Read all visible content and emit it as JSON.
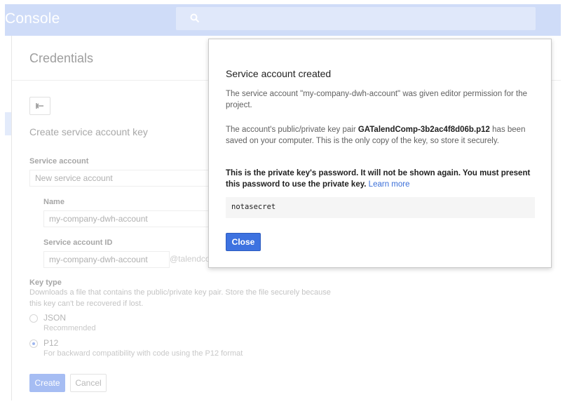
{
  "app": {
    "brand": "Console"
  },
  "search": {
    "icon": "search-icon"
  },
  "page": {
    "title": "Credentials",
    "back_icon": "back-arrow-icon",
    "section_title": "Create service account key",
    "service_account": {
      "label": "Service account",
      "selected": "New service account"
    },
    "name": {
      "label": "Name",
      "value": "my-company-dwh-account"
    },
    "service_account_id": {
      "label": "Service account ID",
      "value": "my-company-dwh-account",
      "suffix": "@talendco"
    },
    "key_type": {
      "label": "Key type",
      "help_line1": "Downloads a file that contains the public/private key pair. Store the file securely because",
      "help_line2": "this key can't be recovered if lost.",
      "options": [
        {
          "label": "JSON",
          "sub": "Recommended",
          "selected": false
        },
        {
          "label": "P12",
          "sub": "For backward compatibility with code using the P12 format",
          "selected": true
        }
      ]
    },
    "create_label": "Create",
    "cancel_label": "Cancel"
  },
  "dialog": {
    "title": "Service account created",
    "para1": "The service account \"my-company-dwh-account\" was given editor permission for the project.",
    "para2_prefix": "The account's public/private key pair ",
    "key_file": "GATalendComp-3b2ac4f8d06b.p12",
    "para2_suffix": " has been saved on your computer. This is the only copy of the key, so store it securely.",
    "warning": "This is the private key's password. It will not be shown again. You must present this password to use the private key.",
    "learn_more": "Learn more",
    "password": "notasecret",
    "close_label": "Close"
  },
  "colors": {
    "primary": "#3d72e0",
    "link": "#3b6fd8",
    "topbar_dimmed": "#cfdcf8"
  }
}
